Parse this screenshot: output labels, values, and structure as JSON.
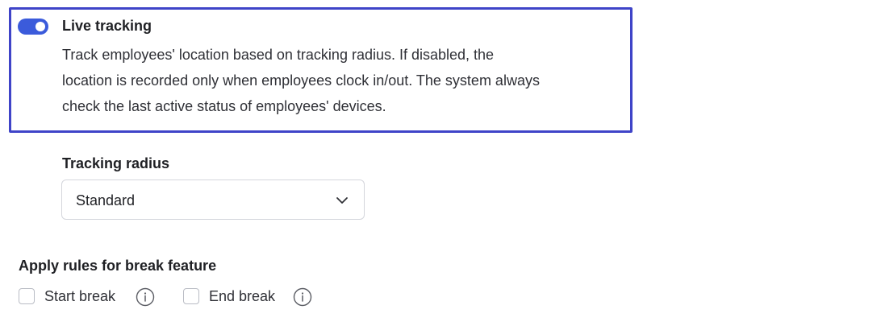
{
  "live_tracking": {
    "enabled": true,
    "title": "Live tracking",
    "description": "Track employees' location based on tracking radius. If disabled, the\nlocation is recorded only when employees clock in/out. The system always\ncheck the last active status of employees' devices."
  },
  "tracking_radius": {
    "label": "Tracking radius",
    "selected": "Standard"
  },
  "break_rules": {
    "label": "Apply rules for break feature",
    "options": [
      {
        "label": "Start break",
        "checked": false
      },
      {
        "label": "End break",
        "checked": false
      }
    ]
  },
  "colors": {
    "accent": "#3b5bdb",
    "focus_outline": "#3f44c8"
  }
}
